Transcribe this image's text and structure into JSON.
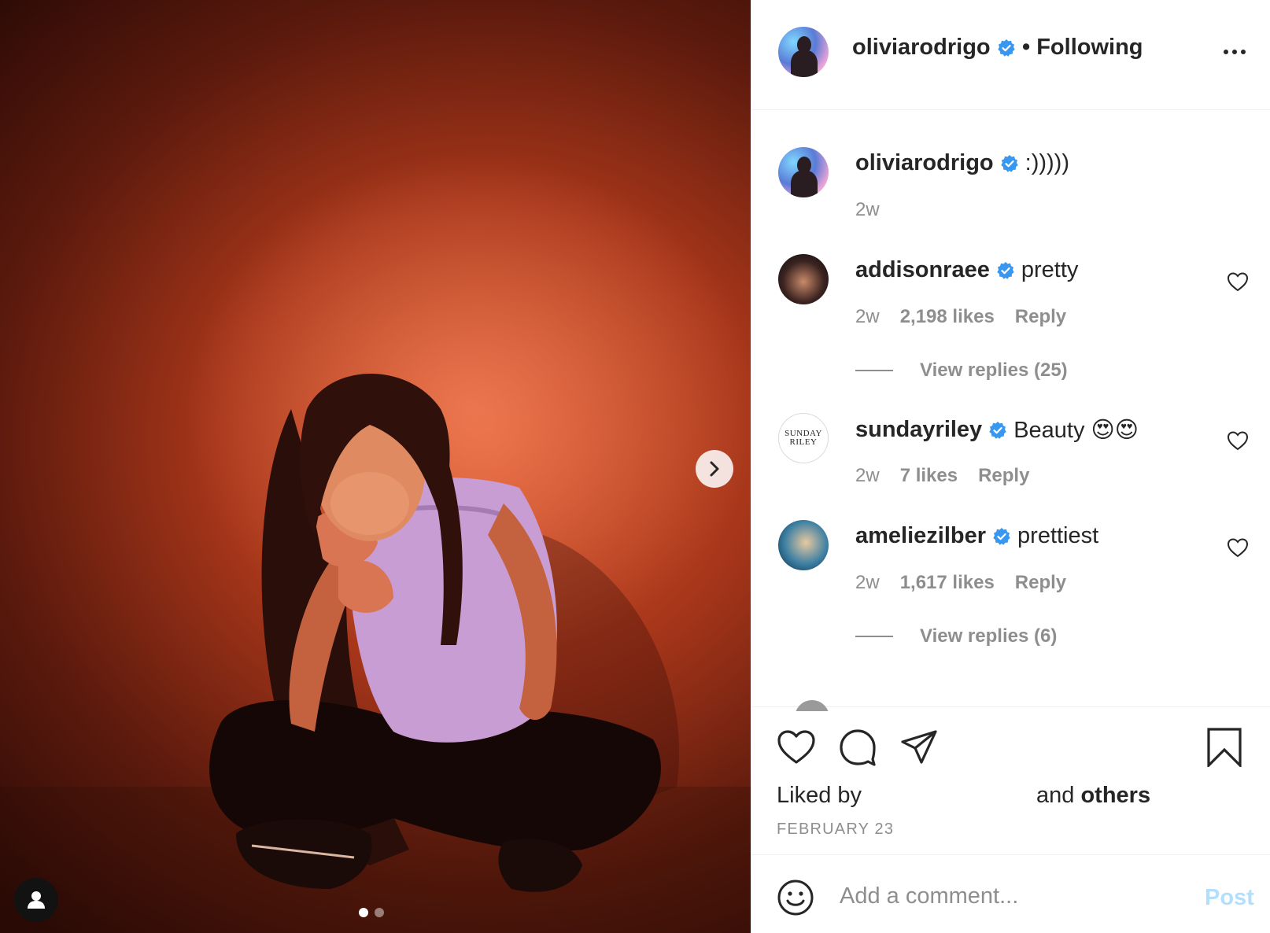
{
  "post": {
    "username": "oliviarodrigo",
    "follow_status": "• Following",
    "liked_by_prefix": "Liked by",
    "and_text": "and",
    "others_text": "others",
    "date": "FEBRUARY 23"
  },
  "carousel": {
    "slides": 2,
    "active_slide": 1
  },
  "comments": [
    {
      "username": "oliviarodrigo",
      "text": ":)))))",
      "age": "2w",
      "likes": "",
      "reply": "",
      "view_replies": ""
    },
    {
      "username": "addisonraee",
      "text": "pretty",
      "age": "2w",
      "likes": "2,198 likes",
      "reply": "Reply",
      "view_replies": "View replies (25)"
    },
    {
      "username": "sundayriley",
      "text": "Beauty 😍😍",
      "age": "2w",
      "likes": "7 likes",
      "reply": "Reply",
      "view_replies": ""
    },
    {
      "username": "ameliezilber",
      "text": "prettiest",
      "age": "2w",
      "likes": "1,617 likes",
      "reply": "Reply",
      "view_replies": "View replies (6)"
    }
  ],
  "sunday_logo": {
    "line1": "SUNDAY",
    "line2": "RILEY"
  },
  "composer": {
    "placeholder": "Add a comment...",
    "post_label": "Post"
  },
  "colors": {
    "verified_blue": "#3897f0",
    "text": "#262626",
    "muted": "#8e8e8e",
    "post_disabled": "#b2dffc"
  },
  "icons": {
    "verified": "verified-badge-icon",
    "more": "more-options-icon",
    "like": "heart-icon",
    "comment": "comment-bubble-icon",
    "share": "paper-plane-icon",
    "save": "bookmark-icon",
    "emoji": "smiley-icon",
    "next": "chevron-right-icon",
    "tag": "person-icon"
  }
}
